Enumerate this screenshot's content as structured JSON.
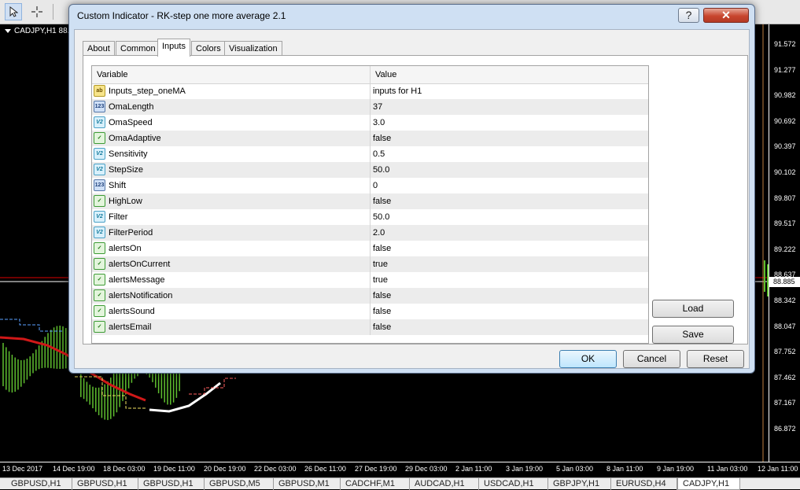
{
  "toolbar": {
    "items": [
      "cursor-icon",
      "crosshair-icon"
    ]
  },
  "chart": {
    "symbol_label": "CADJPY,H1  88.",
    "prices": [
      "91.572",
      "91.277",
      "90.982",
      "90.692",
      "90.397",
      "90.102",
      "89.807",
      "89.517",
      "89.222",
      "88.885",
      "88.637",
      "88.342",
      "88.047",
      "87.752",
      "87.462",
      "87.167",
      "86.872"
    ],
    "current_price": "88.885",
    "times": [
      "13 Dec 2017",
      "14 Dec 19:00",
      "18 Dec 03:00",
      "19 Dec 11:00",
      "20 Dec 19:00",
      "22 Dec 03:00",
      "26 Dec 11:00",
      "27 Dec 19:00",
      "29 Dec 03:00",
      "2 Jan 11:00",
      "3 Jan 19:00",
      "5 Jan 03:00",
      "8 Jan 11:00",
      "9 Jan 19:00",
      "11 Jan 03:00",
      "12 Jan 11:00"
    ]
  },
  "chart_tabs": [
    "GBPUSD,H1",
    "GBPUSD,H1",
    "GBPUSD,H1",
    "GBPUSD,M5",
    "GBPUSD,M1",
    "CADCHF,M1",
    "AUDCAD,H1",
    "USDCAD,H1",
    "GBPJPY,H1",
    "EURUSD,H4",
    "CADJPY,H1"
  ],
  "active_chart_tab": "CADJPY,H1",
  "dialog": {
    "title": "Custom Indicator - RK-step one more average 2.1",
    "help_label": "?",
    "close_label": "✕",
    "tabs": [
      "About",
      "Common",
      "Inputs",
      "Colors",
      "Visualization"
    ],
    "active_tab": "Inputs",
    "columns": {
      "variable": "Variable",
      "value": "Value"
    },
    "params": [
      {
        "name": "Inputs_step_oneMA",
        "value": "inputs for H1",
        "type": "str",
        "icon": "ab"
      },
      {
        "name": "OmaLength",
        "value": "37",
        "type": "int",
        "icon": "123"
      },
      {
        "name": "OmaSpeed",
        "value": "3.0",
        "type": "dbl",
        "icon": "V2"
      },
      {
        "name": "OmaAdaptive",
        "value": "false",
        "type": "bool",
        "icon": "✓"
      },
      {
        "name": "Sensitivity",
        "value": "0.5",
        "type": "dbl",
        "icon": "V2"
      },
      {
        "name": "StepSize",
        "value": "50.0",
        "type": "dbl",
        "icon": "V2"
      },
      {
        "name": "Shift",
        "value": "0",
        "type": "int",
        "icon": "123"
      },
      {
        "name": "HighLow",
        "value": "false",
        "type": "bool",
        "icon": "✓"
      },
      {
        "name": "Filter",
        "value": "50.0",
        "type": "dbl",
        "icon": "V2"
      },
      {
        "name": "FilterPeriod",
        "value": "2.0",
        "type": "dbl",
        "icon": "V2"
      },
      {
        "name": "alertsOn",
        "value": "false",
        "type": "bool",
        "icon": "✓"
      },
      {
        "name": "alertsOnCurrent",
        "value": "true",
        "type": "bool",
        "icon": "✓"
      },
      {
        "name": "alertsMessage",
        "value": "true",
        "type": "bool",
        "icon": "✓"
      },
      {
        "name": "alertsNotification",
        "value": "false",
        "type": "bool",
        "icon": "✓"
      },
      {
        "name": "alertsSound",
        "value": "false",
        "type": "bool",
        "icon": "✓"
      },
      {
        "name": "alertsEmail",
        "value": "false",
        "type": "bool",
        "icon": "✓"
      }
    ],
    "buttons": {
      "load": "Load",
      "save": "Save",
      "ok": "OK",
      "cancel": "Cancel",
      "reset": "Reset"
    }
  }
}
